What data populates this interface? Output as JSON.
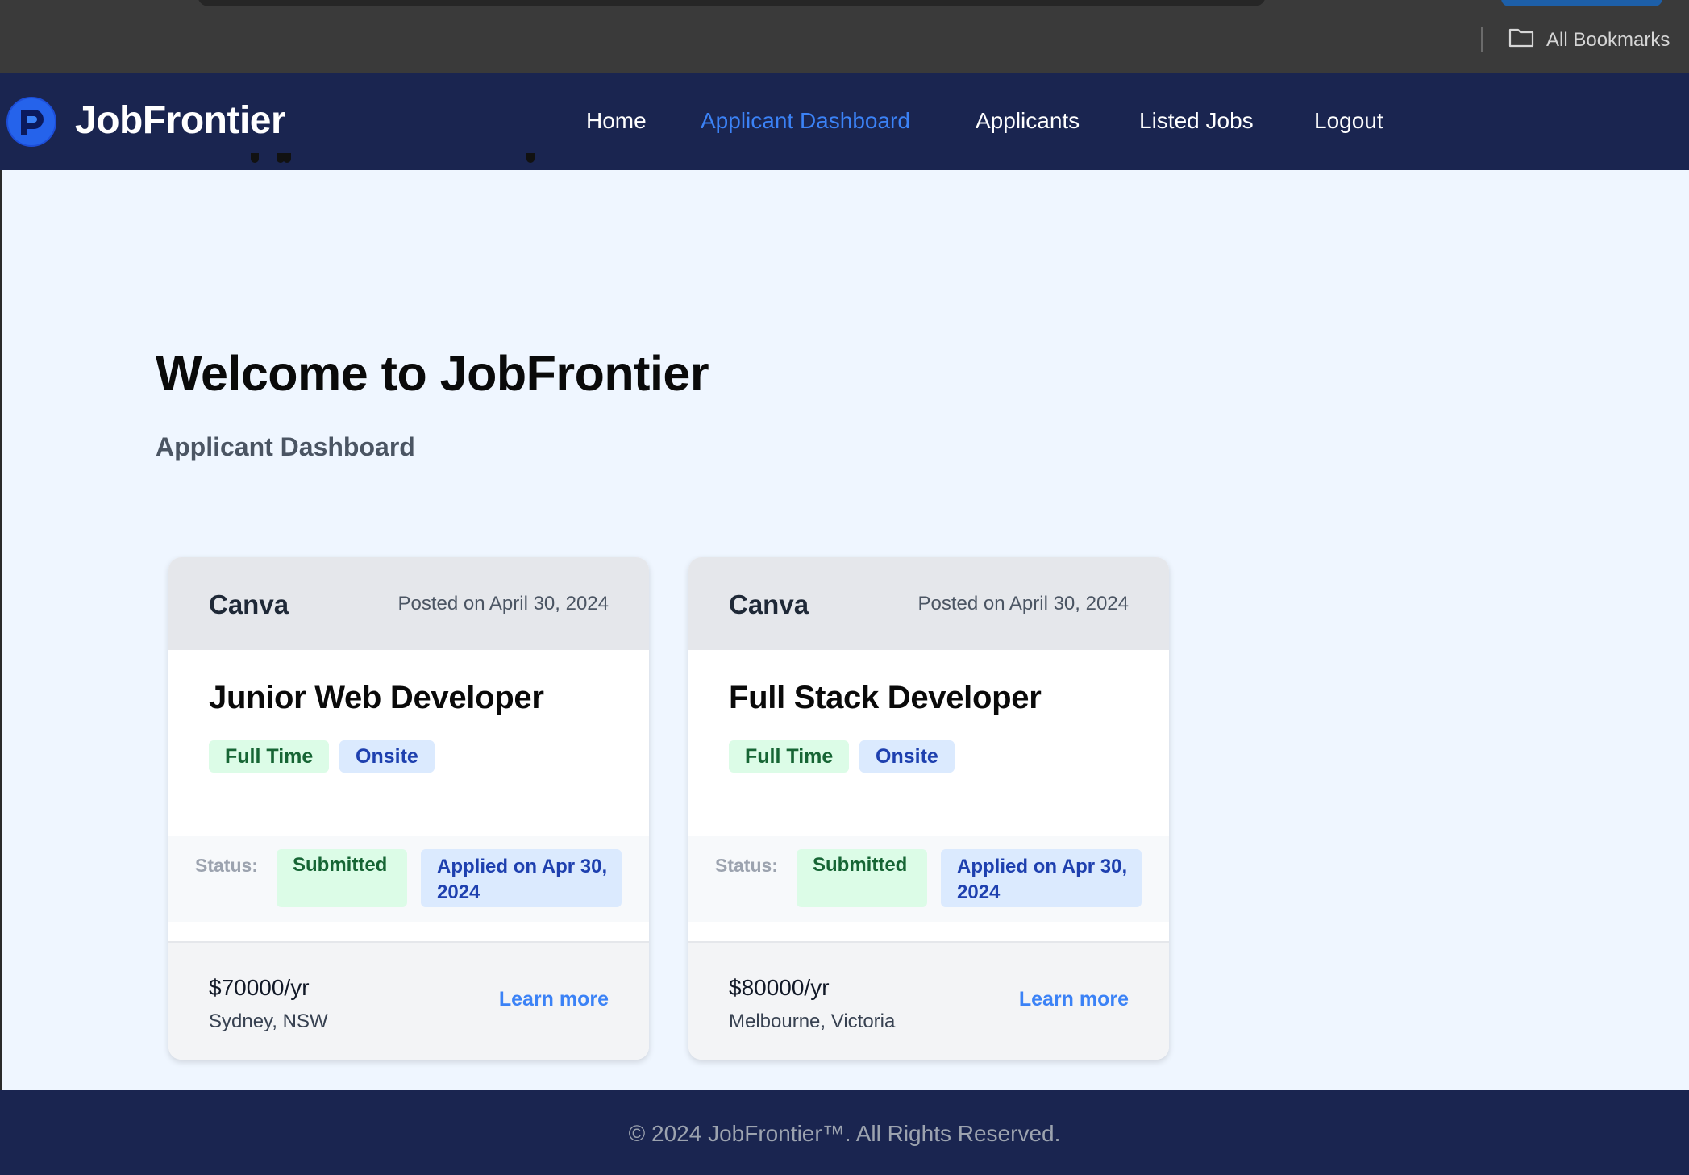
{
  "browser": {
    "bookmarks_label": "All Bookmarks",
    "bookmarks_icon": "folder-icon"
  },
  "navbar": {
    "brand": "JobFrontier",
    "logo_icon": "jobfrontier-logo",
    "links": [
      {
        "label": "Home",
        "active": false
      },
      {
        "label": "Applicant Dashboard",
        "active": true
      },
      {
        "label": "Applicants",
        "active": false
      },
      {
        "label": "Listed Jobs",
        "active": false
      },
      {
        "label": "Logout",
        "active": false
      }
    ],
    "active_color": "#3b82f6",
    "background": "#1a2550"
  },
  "hero": {
    "title": "Welcome to JobFrontier",
    "subtitle": "Applicant Dashboard"
  },
  "cards": [
    {
      "company": "Canva",
      "posted": "Posted on April 30, 2024",
      "title": "Junior Web Developer",
      "tags": [
        "Full Time",
        "Onsite"
      ],
      "status_label": "Status:",
      "status": "Submitted",
      "applied": "Applied on Apr 30, 2024",
      "salary": "$70000/yr",
      "location": "Sydney, NSW",
      "cta": "Learn more"
    },
    {
      "company": "Canva",
      "posted": "Posted on April 30, 2024",
      "title": "Full Stack Developer",
      "tags": [
        "Full Time",
        "Onsite"
      ],
      "status_label": "Status:",
      "status": "Submitted",
      "applied": "Applied on Apr 30, 2024",
      "salary": "$80000/yr",
      "location": "Melbourne, Victoria",
      "cta": "Learn more"
    }
  ],
  "footer": {
    "copyright": "© 2024 JobFrontier™. All Rights Reserved."
  }
}
